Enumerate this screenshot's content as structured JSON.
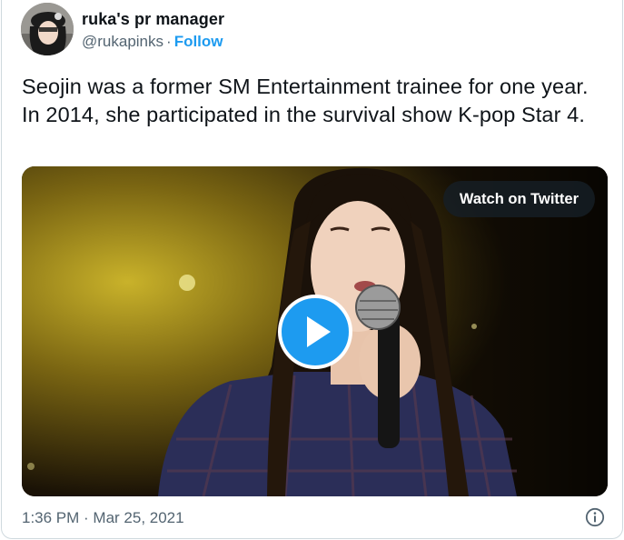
{
  "author": {
    "name": "ruka's pr manager",
    "handle": "@rukapinks",
    "separator": "·",
    "follow_label": "Follow"
  },
  "tweet": {
    "text": "Seojin was a former SM Entertainment trainee for one year. In 2014, she participated in the survival show K-pop Star 4."
  },
  "media": {
    "type": "video",
    "watch_label": "Watch on Twitter",
    "play_icon": "play-icon"
  },
  "meta": {
    "timestamp": "1:36 PM · Mar 25, 2021",
    "info_icon": "info-icon"
  },
  "colors": {
    "accent": "#1d9bf0",
    "text_primary": "#0f1419",
    "text_secondary": "#536471",
    "border": "#cfd9de"
  }
}
